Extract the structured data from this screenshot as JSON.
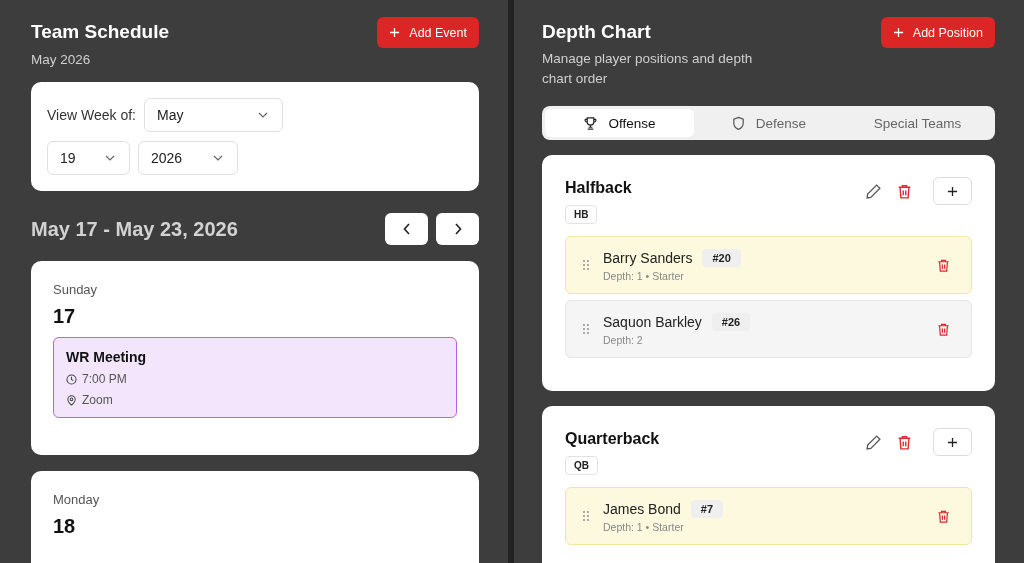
{
  "schedule": {
    "title": "Team Schedule",
    "subtitle": "May 2026",
    "add_button": "Add Event",
    "filter": {
      "label": "View Week of:",
      "month": "May",
      "week": "19",
      "year": "2026"
    },
    "week_range": "May 17 - May 23, 2026",
    "days": [
      {
        "weekday": "Sunday",
        "date": "17",
        "events": [
          {
            "title": "WR Meeting",
            "time": "7:00 PM",
            "location": "Zoom"
          }
        ]
      },
      {
        "weekday": "Monday",
        "date": "18"
      }
    ]
  },
  "depth_chart": {
    "title": "Depth Chart",
    "description": "Manage player positions and depth chart order",
    "add_button": "Add Position",
    "tabs": [
      {
        "label": "Offense",
        "selected": true
      },
      {
        "label": "Defense",
        "selected": false
      },
      {
        "label": "Special Teams",
        "selected": false
      }
    ],
    "positions": [
      {
        "name": "Halfback",
        "abbr": "HB",
        "players": [
          {
            "name": "Barry Sanders",
            "number": "#20",
            "depth": "Depth: 1 • Starter",
            "starter": true
          },
          {
            "name": "Saquon Barkley",
            "number": "#26",
            "depth": "Depth: 2",
            "starter": false
          }
        ]
      },
      {
        "name": "Quarterback",
        "abbr": "QB",
        "players": [
          {
            "name": "James Bond",
            "number": "#7",
            "depth": "Depth: 1 • Starter",
            "starter": true
          }
        ]
      }
    ]
  }
}
